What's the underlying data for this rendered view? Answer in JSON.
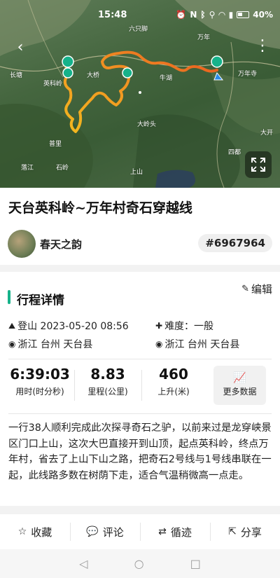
{
  "status_bar": {
    "time": "15:48",
    "battery": "40%"
  },
  "map": {
    "labels": [
      "六只脚",
      "万年",
      "牛湖",
      "英科岭",
      "大桥",
      "万年寺",
      "大岭头",
      "普里",
      "长塘",
      "石岭",
      "四都",
      "落江",
      "上山",
      "大开"
    ]
  },
  "route": {
    "title": "天台英科岭~万年村奇石穿越线",
    "author": "春天之韵",
    "id": "#6967964"
  },
  "details": {
    "section_title": "行程详情",
    "edit_label": "编辑",
    "activity": "登山 2023-05-20 08:56",
    "difficulty": "难度：一般",
    "start_location": "浙江 台州 天台县",
    "end_location": "浙江 台州 天台县"
  },
  "stats": {
    "duration": {
      "value": "6:39:03",
      "label": "用时(时分秒)"
    },
    "distance": {
      "value": "8.83",
      "label": "里程(公里)"
    },
    "ascent": {
      "value": "460",
      "label": "上升(米)"
    },
    "more_label": "更多数据"
  },
  "description": "一行38人顺利完成此次探寻奇石之驴，以前来过是龙穿峡景区门口上山，这次大巴直接开到山顶，起点英科岭，终点万年村，省去了上山下山之路，把奇石2号线与1号线串联在一起，此线路多数在树荫下走，适合气温稍微高一点走。",
  "actions": {
    "favorite": "收藏",
    "comment": "评论",
    "follow_track": "循迹",
    "share": "分享"
  },
  "colors": {
    "accent": "#16b28a",
    "track_start": "#f3b81f",
    "track_end": "#e8531f"
  }
}
